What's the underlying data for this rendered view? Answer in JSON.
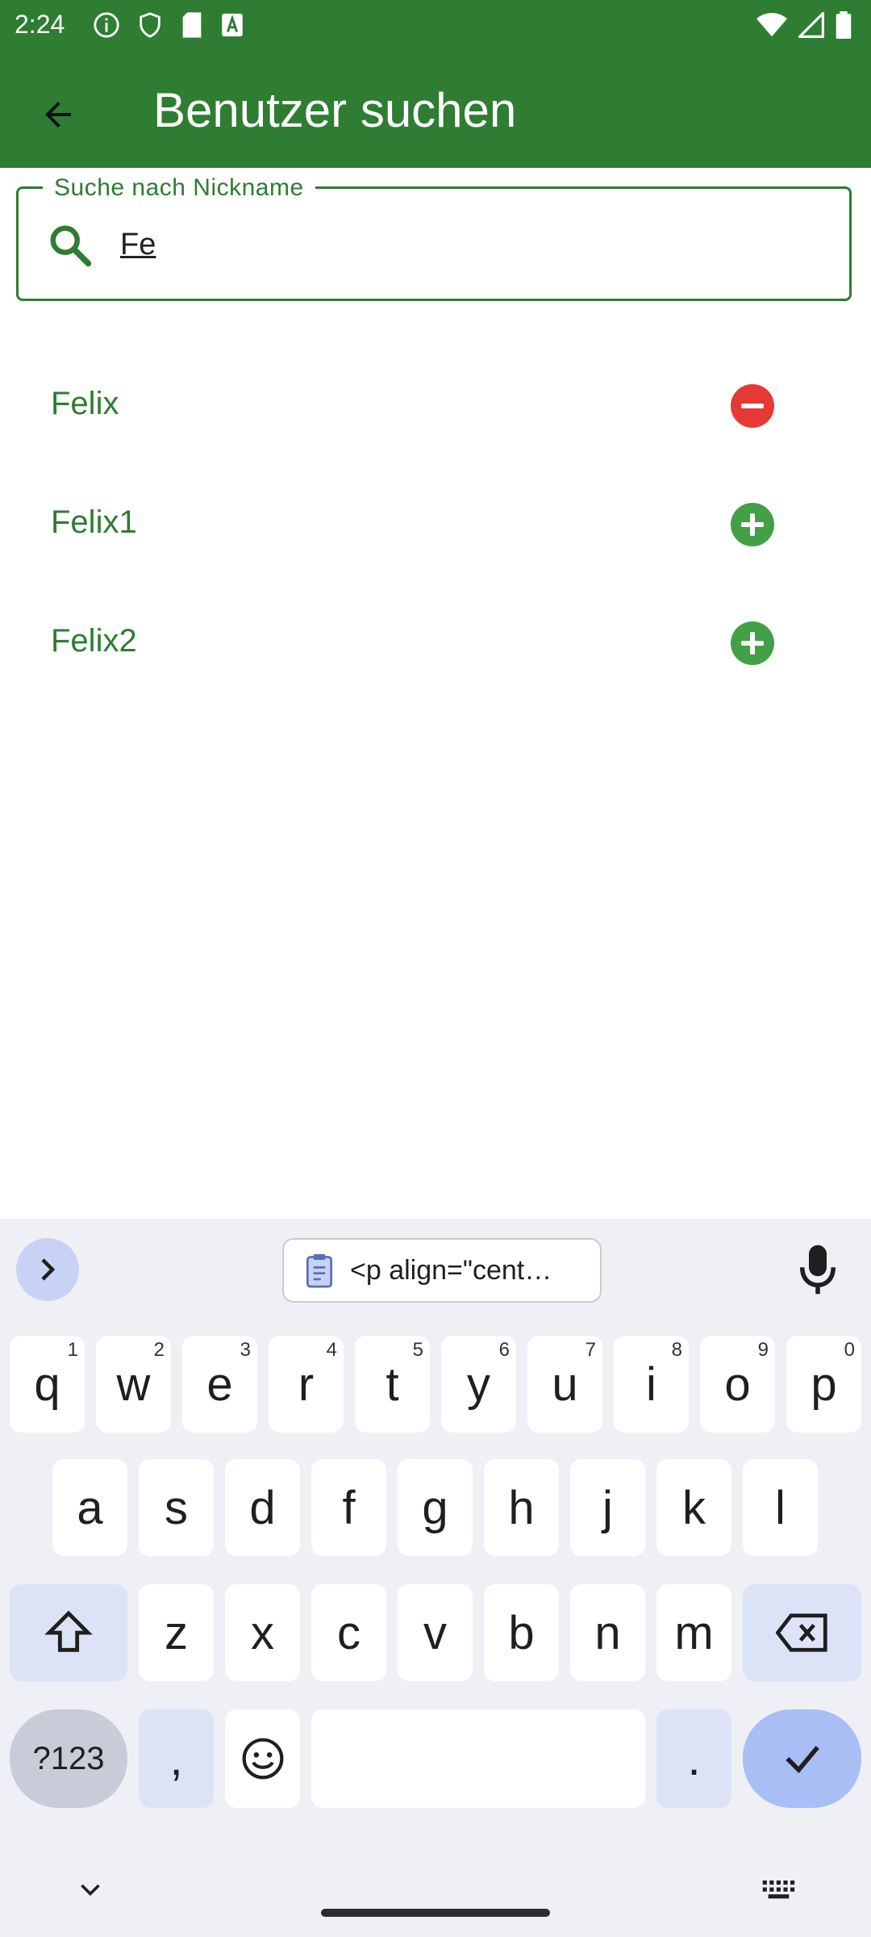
{
  "status_bar": {
    "time": "2:24"
  },
  "app_bar": {
    "title": "Benutzer suchen"
  },
  "search": {
    "label": "Suche nach Nickname",
    "value": "Fe"
  },
  "results": [
    {
      "name": "Felix",
      "action": "remove"
    },
    {
      "name": "Felix1",
      "action": "add"
    },
    {
      "name": "Felix2",
      "action": "add"
    }
  ],
  "keyboard": {
    "clipboard_text": "<p align=\"cent…",
    "row1": [
      {
        "key": "q",
        "hint": "1"
      },
      {
        "key": "w",
        "hint": "2"
      },
      {
        "key": "e",
        "hint": "3"
      },
      {
        "key": "r",
        "hint": "4"
      },
      {
        "key": "t",
        "hint": "5"
      },
      {
        "key": "y",
        "hint": "6"
      },
      {
        "key": "u",
        "hint": "7"
      },
      {
        "key": "i",
        "hint": "8"
      },
      {
        "key": "o",
        "hint": "9"
      },
      {
        "key": "p",
        "hint": "0"
      }
    ],
    "row2": [
      "a",
      "s",
      "d",
      "f",
      "g",
      "h",
      "j",
      "k",
      "l"
    ],
    "row3": [
      "z",
      "x",
      "c",
      "v",
      "b",
      "n",
      "m"
    ],
    "sym_label": "?123",
    "comma": ",",
    "period": "."
  },
  "colors": {
    "primary": "#2e7d32",
    "remove": "#e53935",
    "add": "#43a047"
  }
}
